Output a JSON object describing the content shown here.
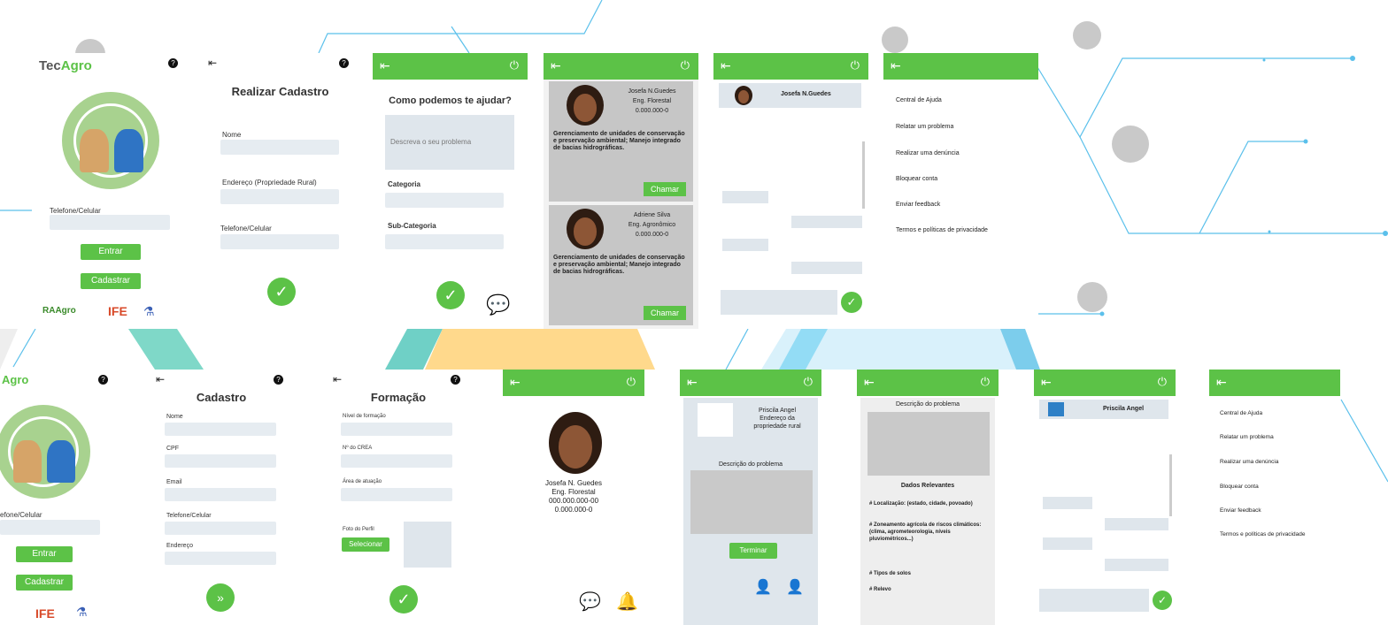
{
  "brand": {
    "name_part1": "Tec",
    "name_part2": "Agro",
    "lower_name": "Agro"
  },
  "colors": {
    "accent_green": "#5cc247",
    "line_blue": "#5bc0eb",
    "field_gray": "#e6ecf1"
  },
  "login": {
    "phone_label": "Telefone/Celular",
    "phone_label_cut": "efone/Celular",
    "enter": "Entrar",
    "register": "Cadastrar",
    "partner_logo": "RAAgro",
    "partner_logo2": "IFE"
  },
  "register": {
    "title": "Realizar Cadastro",
    "name": "Nome",
    "address": "Endereço (Propriedade Rural)",
    "phone": "Telefone/Celular"
  },
  "help": {
    "title": "Como podemos te ajudar?",
    "placeholder": "Descreva o seu problema",
    "category": "Categoria",
    "subcategory": "Sub-Categoria"
  },
  "specialists": [
    {
      "name": "Josefa N.Guedes",
      "role": "Eng. Florestal",
      "phone": "0.000.000-0",
      "desc": "Gerenciamento de unidades de conservação e preservação ambiental; Manejo integrado de bacias hidrográficas.",
      "action": "Chamar"
    },
    {
      "name": "Adriene Silva",
      "role": "Eng. Agronômico",
      "phone": "0.000.000-0",
      "desc": "Gerenciamento de unidades de conservação e preservação ambiental; Manejo integrado de bacias hidrográficas.",
      "action": "Chamar"
    }
  ],
  "chat_top": {
    "contact": "Josefa N.Guedes"
  },
  "menu": {
    "items": [
      "Central de Ajuda",
      "Relatar um problema",
      "Realizar uma denúncia",
      "Bloquear conta",
      "Enviar feedback",
      "Termos e políticas de privacidade"
    ]
  },
  "cadastro": {
    "title": "Cadastro",
    "fields": [
      "Nome",
      "CPF",
      "Email",
      "Telefone/Celular",
      "Endereço"
    ]
  },
  "formacao": {
    "title": "Formação",
    "fields": [
      "Nível de formação",
      "Nº do CREA",
      "Área de atuação"
    ],
    "photo_label": "Foto do Perfil",
    "select": "Selecionar"
  },
  "profile": {
    "name": "Josefa N. Guedes",
    "role": "Eng. Florestal",
    "doc": "000.000.000-00",
    "phone": "0.000.000-0"
  },
  "request": {
    "name": "Priscila Angel",
    "address_line1": "Endereço da",
    "address_line2": "propriedade rural",
    "problem_label": "Descrição do problema",
    "button": "Terminar"
  },
  "details": {
    "title": "Descrição do problema",
    "data_title": "Dados Relevantes",
    "items": [
      "# Localização: (estado, cidade, povoado)",
      "# Zoneamento agrícola de riscos climáticos: (clima, agrometeorologia, níveis pluviométricos...)",
      "# Tipos de solos",
      "# Relevo"
    ]
  },
  "chat_bottom": {
    "contact": "Priscila Angel"
  }
}
